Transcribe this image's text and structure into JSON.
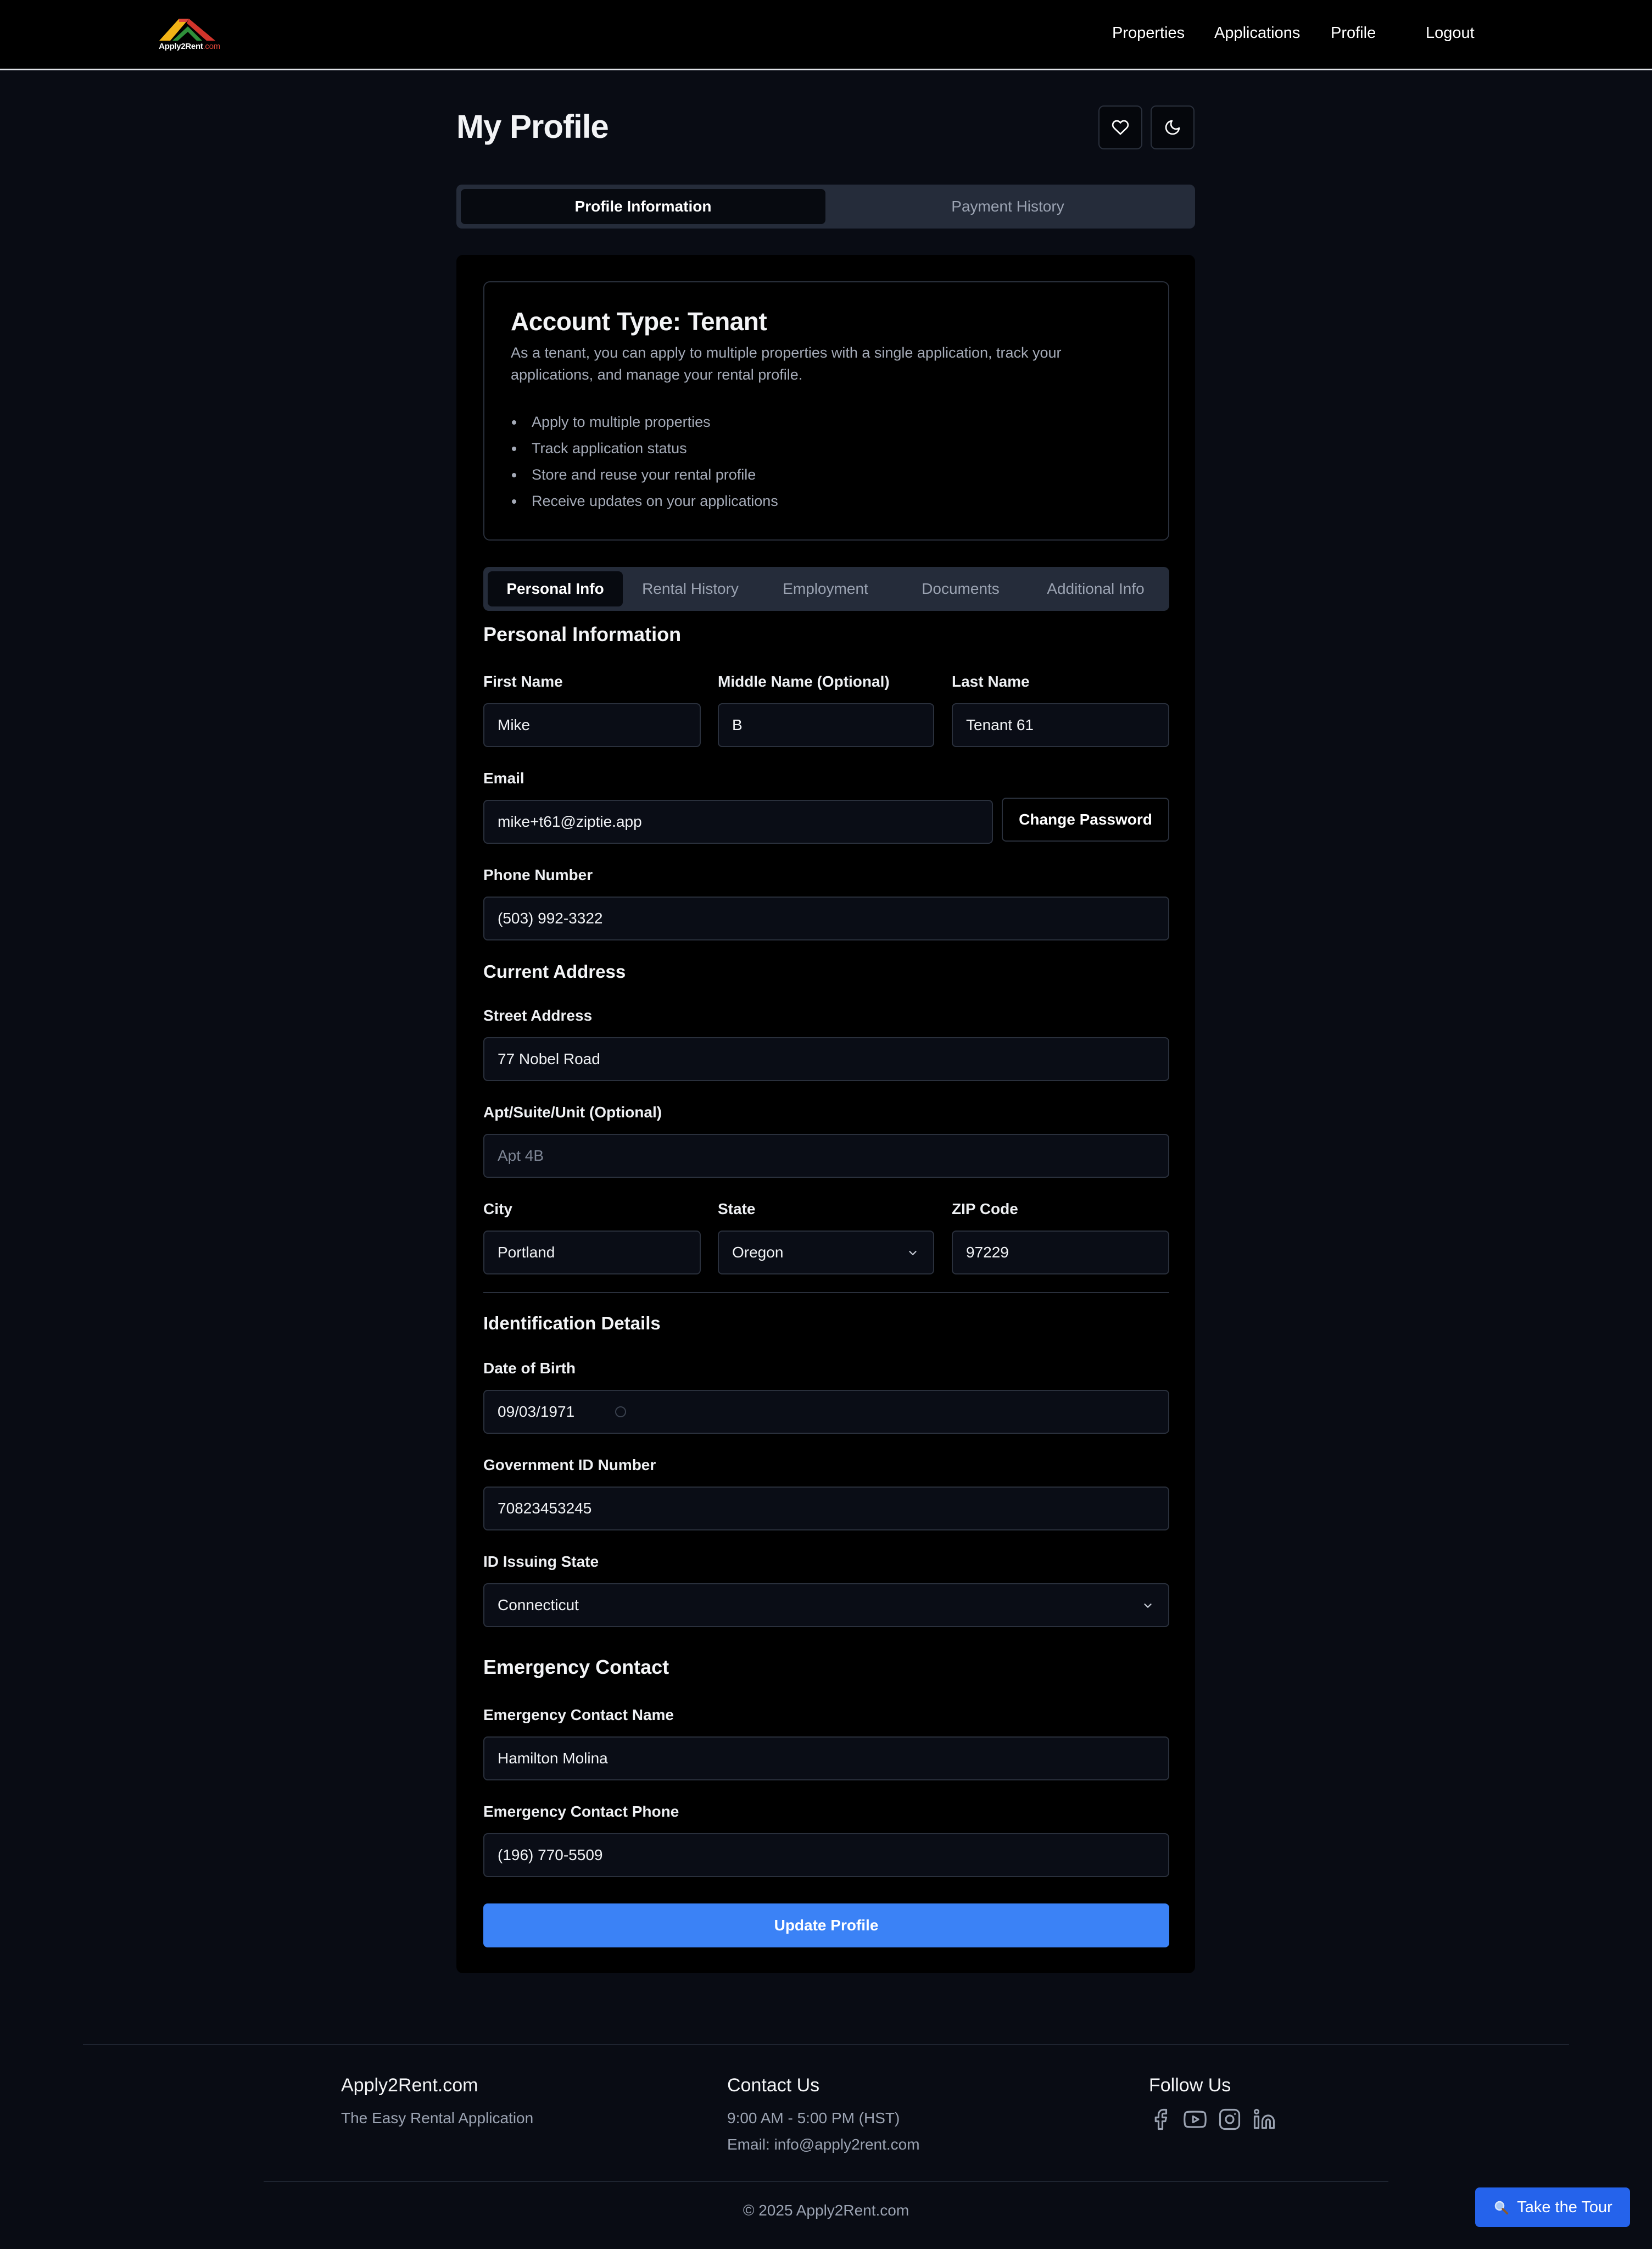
{
  "brand": {
    "logo_text": "Apply2Rent",
    "logo_suffix": ".com"
  },
  "nav": {
    "properties": "Properties",
    "applications": "Applications",
    "profile": "Profile",
    "logout": "Logout"
  },
  "page": {
    "title": "My Profile"
  },
  "main_tabs": {
    "profile_information": "Profile Information",
    "payment_history": "Payment History"
  },
  "account": {
    "title": "Account Type: Tenant",
    "description": "As a tenant, you can apply to multiple properties with a single application, track your applications, and manage your rental profile.",
    "features": [
      "Apply to multiple properties",
      "Track application status",
      "Store and reuse your rental profile",
      "Receive updates on your applications"
    ]
  },
  "sub_tabs": [
    "Personal Info",
    "Rental History",
    "Employment",
    "Documents",
    "Additional Info"
  ],
  "personal": {
    "title": "Personal Information",
    "first_name_label": "First Name",
    "first_name": "Mike",
    "middle_name_label": "Middle Name (Optional)",
    "middle_name": "B",
    "last_name_label": "Last Name",
    "last_name": "Tenant 61",
    "email_label": "Email",
    "email": "mike+t61@ziptie.app",
    "change_password": "Change Password",
    "phone_label": "Phone Number",
    "phone": "(503) 992-3322"
  },
  "address": {
    "title": "Current Address",
    "street_label": "Street Address",
    "street": "77 Nobel Road",
    "apt_label": "Apt/Suite/Unit (Optional)",
    "apt_placeholder": "Apt 4B",
    "city_label": "City",
    "city": "Portland",
    "state_label": "State",
    "state": "Oregon",
    "zip_label": "ZIP Code",
    "zip": "97229"
  },
  "identification": {
    "title": "Identification Details",
    "dob_label": "Date of Birth",
    "dob": "09/03/1971",
    "gov_id_label": "Government ID Number",
    "gov_id": "70823453245",
    "issuing_state_label": "ID Issuing State",
    "issuing_state": "Connecticut"
  },
  "emergency": {
    "title": "Emergency Contact",
    "name_label": "Emergency Contact Name",
    "name": "Hamilton Molina",
    "phone_label": "Emergency Contact Phone",
    "phone": "(196) 770-5509"
  },
  "update_button": "Update Profile",
  "footer": {
    "brand": "Apply2Rent.com",
    "tagline": "The Easy Rental Application",
    "contact_title": "Contact Us",
    "hours": "9:00 AM - 5:00 PM (HST)",
    "email": "Email: info@apply2rent.com",
    "follow_title": "Follow Us",
    "social_icons": [
      "facebook-icon",
      "youtube-icon",
      "instagram-icon",
      "linkedin-icon"
    ],
    "copyright": "© 2025 Apply2Rent.com"
  },
  "tour_button": "Take the Tour",
  "colors": {
    "background": "#090c14",
    "card": "#000000",
    "border": "#2a303c",
    "tab_bar": "#252c3a",
    "primary": "#3b82f6",
    "tour": "#2563eb"
  }
}
